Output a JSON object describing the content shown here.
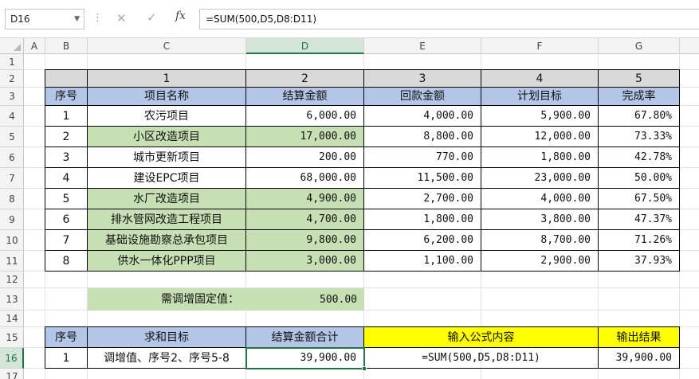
{
  "formula_bar": {
    "name_box": "D16",
    "dots": "⋮",
    "cancel_symbol": "✕",
    "enter_symbol": "✓",
    "fx_symbol": "fx",
    "formula": "=SUM(500,D5,D8:D11)"
  },
  "columns": [
    "A",
    "B",
    "C",
    "D",
    "E",
    "F",
    "G"
  ],
  "rows": [
    "1",
    "2",
    "3",
    "4",
    "5",
    "6",
    "7",
    "8",
    "9",
    "10",
    "11",
    "12",
    "13",
    "14",
    "15",
    "16",
    "17"
  ],
  "active_cell": "D16",
  "colors": {
    "header_blue": "#b4c6e7",
    "green_fill": "#c6e0b4",
    "gray_fill": "#d9d9d9",
    "yellow_fill": "#ffff00",
    "selection": "#217346"
  },
  "table1": {
    "index_row": [
      "1",
      "2",
      "3",
      "4",
      "5"
    ],
    "headers": [
      "序号",
      "项目名称",
      "结算金额",
      "回款金额",
      "计划目标",
      "完成率"
    ],
    "rows": [
      {
        "no": "1",
        "name": "农污项目",
        "settle": "6,000.00",
        "payback": "4,000.00",
        "target": "5,900.00",
        "rate": "67.80%",
        "green": false
      },
      {
        "no": "2",
        "name": "小区改造项目",
        "settle": "17,000.00",
        "payback": "8,800.00",
        "target": "12,000.00",
        "rate": "73.33%",
        "green": true
      },
      {
        "no": "3",
        "name": "城市更新项目",
        "settle": "200.00",
        "payback": "770.00",
        "target": "1,800.00",
        "rate": "42.78%",
        "green": false
      },
      {
        "no": "4",
        "name": "建设EPC项目",
        "settle": "68,000.00",
        "payback": "11,500.00",
        "target": "23,000.00",
        "rate": "50.00%",
        "green": false
      },
      {
        "no": "5",
        "name": "水厂改造项目",
        "settle": "4,900.00",
        "payback": "2,700.00",
        "target": "4,000.00",
        "rate": "67.50%",
        "green": true
      },
      {
        "no": "6",
        "name": "排水管网改造工程项目",
        "settle": "4,700.00",
        "payback": "1,800.00",
        "target": "3,800.00",
        "rate": "47.37%",
        "green": true
      },
      {
        "no": "7",
        "name": "基础设施勘察总承包项目",
        "settle": "9,800.00",
        "payback": "6,200.00",
        "target": "8,700.00",
        "rate": "71.26%",
        "green": true
      },
      {
        "no": "8",
        "name": "供水一体化PPP项目",
        "settle": "3,000.00",
        "payback": "1,100.00",
        "target": "2,900.00",
        "rate": "37.93%",
        "green": true
      }
    ]
  },
  "fixed_value": {
    "label": "需调增固定值：",
    "value": "500.00"
  },
  "table2": {
    "headers": [
      "序号",
      "求和目标",
      "结算金额合计",
      "输入公式内容",
      "输出结果"
    ],
    "row": [
      "1",
      "调增值、序号2、序号5-8",
      "39,900.00",
      "=SUM(500,D5,D8:D11)",
      "39,900.00"
    ]
  }
}
